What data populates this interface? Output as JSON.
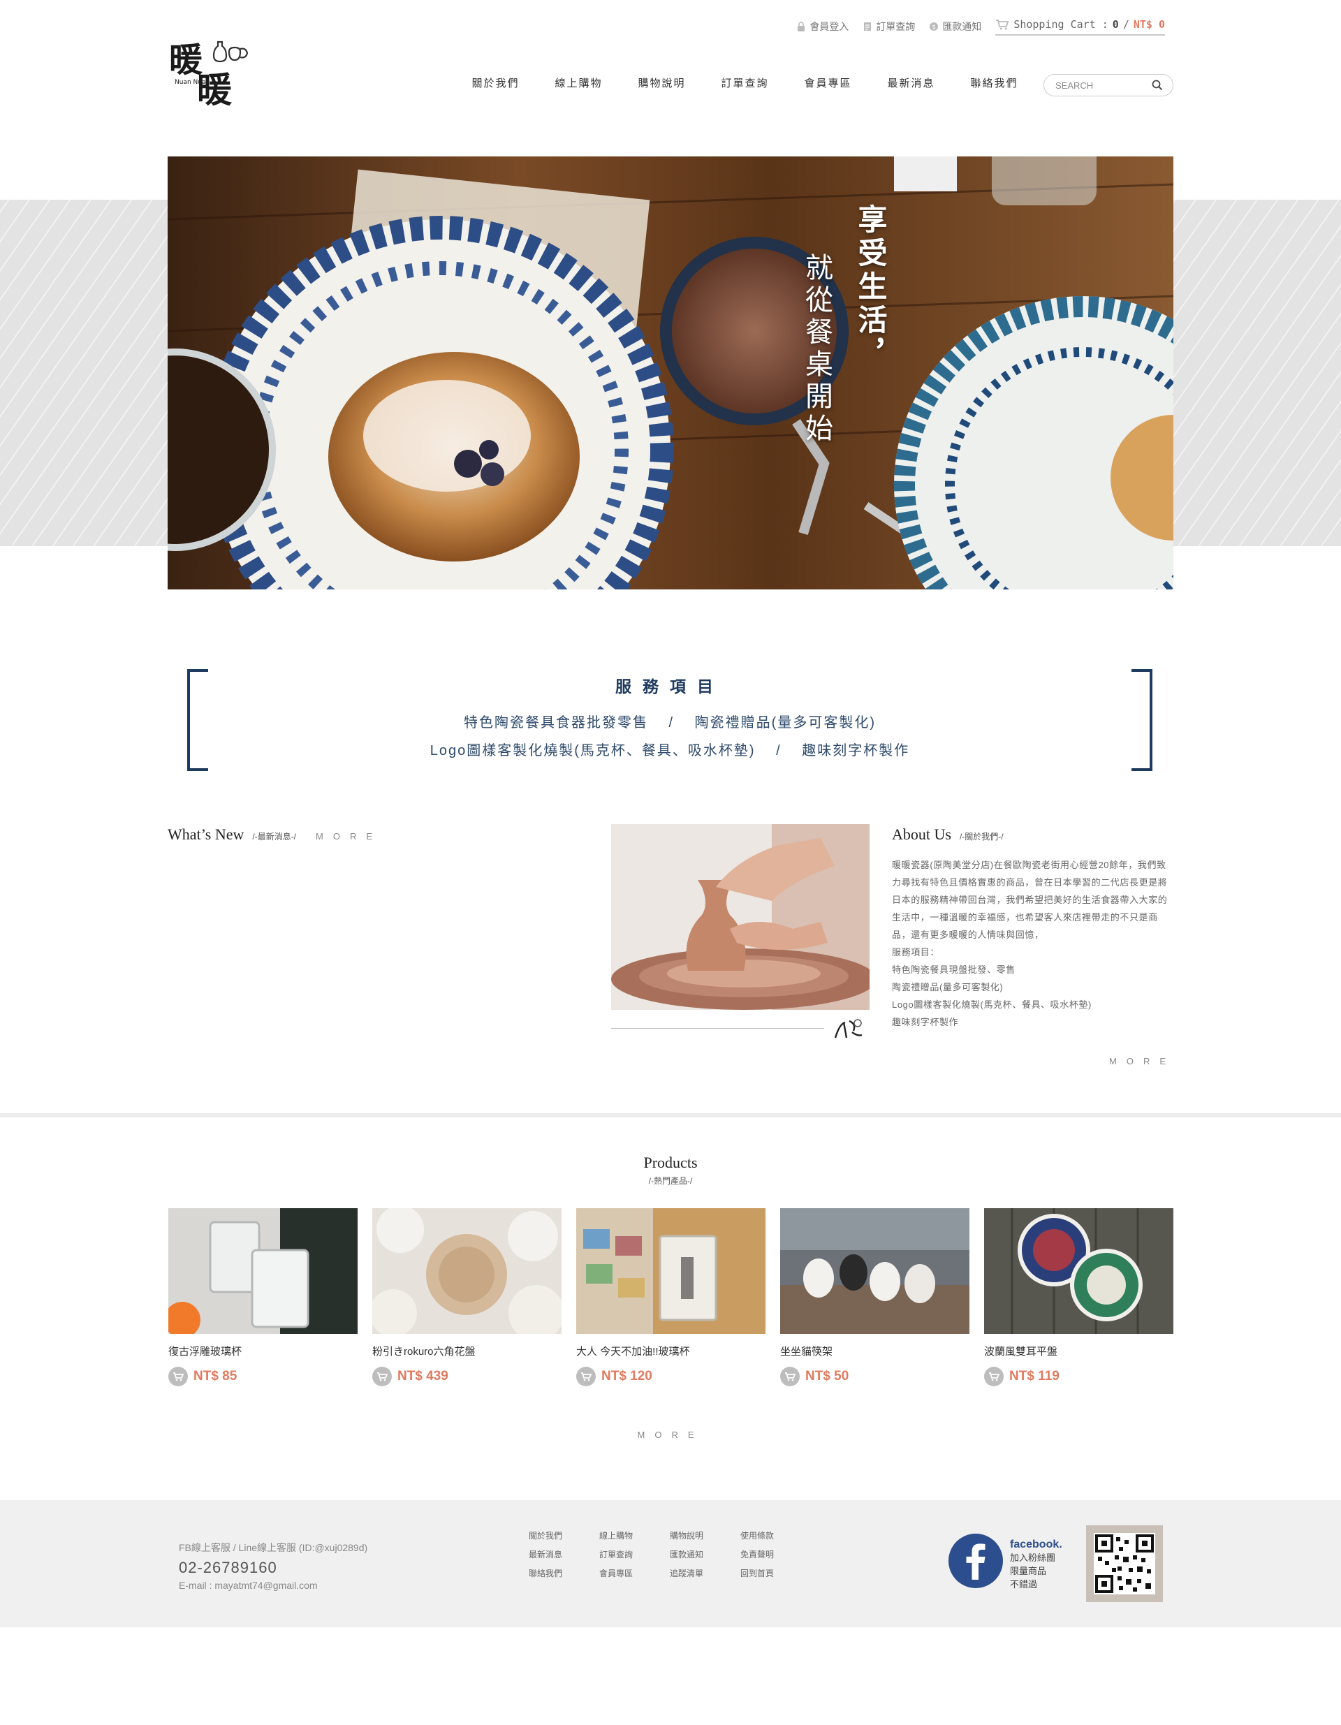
{
  "brand": {
    "logo_text_top": "暖",
    "logo_text_bottom": "暖",
    "logo_sub": "Nuan Nuan"
  },
  "utility": {
    "login": "會員登入",
    "order_lookup": "訂單查詢",
    "remit_notice": "匯款通知",
    "cart_label": "Shopping Cart :",
    "cart_count": "0",
    "cart_sep": "/",
    "cart_total": "NT$ 0"
  },
  "nav": {
    "items": [
      {
        "label": "關於我們"
      },
      {
        "label": "線上購物"
      },
      {
        "label": "購物說明"
      },
      {
        "label": "訂單查詢"
      },
      {
        "label": "會員專區"
      },
      {
        "label": "最新消息"
      },
      {
        "label": "聯絡我們"
      }
    ],
    "search_placeholder": "SEARCH"
  },
  "hero": {
    "line1": "享受生活，",
    "line2": "就從餐桌開始"
  },
  "services": {
    "title": "服務項目",
    "row1": [
      "特色陶瓷餐具食器批發零售",
      "陶瓷禮贈品(量多可客製化)"
    ],
    "row2": [
      "Logo圖樣客製化燒製(馬克杯、餐具、吸水杯墊)",
      "趣味刻字杯製作"
    ],
    "separator": "/"
  },
  "whats_new": {
    "title": "What’s New",
    "subtitle": "/-最新消息-/",
    "more": "MORE"
  },
  "about": {
    "title": "About Us",
    "subtitle": "/-關於我們-/",
    "body": [
      "暖暖瓷器(原陶美堂分店)在餐歐陶瓷老街用心經營20餘年，我們致力尋找有特色且價格實惠的商品，曾在日本學習的二代店長更是將日本的服務精神帶回台灣，我們希望把美好的生活食器帶入大家的生活中，一種溫暖的幸福感，也希望客人來店裡帶走的不只是商品，還有更多暖暖的人情味與回憶，",
      "服務項目：",
      "特色陶瓷餐具現盤批發、零售",
      "陶瓷禮贈品(量多可客製化)",
      "Logo圖樣客製化燒製(馬克杯、餐具、吸水杯墊)",
      "趣味刻字杯製作"
    ],
    "more": "MORE"
  },
  "products": {
    "title": "Products",
    "subtitle": "/-熱門產品-/",
    "more": "MORE",
    "items": [
      {
        "name": "復古浮雕玻璃杯",
        "price": "NT$ 85"
      },
      {
        "name": "粉引きrokuro六角花盤",
        "price": "NT$ 439"
      },
      {
        "name": "大人 今天不加油!!玻璃杯",
        "price": "NT$ 120"
      },
      {
        "name": "坐坐貓筷架",
        "price": "NT$ 50"
      },
      {
        "name": "波蘭風雙耳平盤",
        "price": "NT$ 119"
      }
    ]
  },
  "footer": {
    "service": "FB線上客服 / Line線上客服 (ID:@xuj0289d)",
    "phone": "02-26789160",
    "email": "E-mail : mayatmt74@gmail.com",
    "links": [
      "關於我們",
      "線上購物",
      "購物說明",
      "使用條款",
      "最新消息",
      "訂單查詢",
      "匯款通知",
      "免責聲明",
      "聯絡我們",
      "會員專區",
      "追蹤清單",
      "回到首頁"
    ],
    "fb_brand": "facebook.",
    "fb_lines": [
      "加入粉絲團",
      "限量商品",
      "不錯過"
    ]
  },
  "colors": {
    "navy": "#1f3a5f",
    "price": "#e07a5f",
    "footer_bg": "#f0f0f0",
    "facebook": "#2c4e8e"
  }
}
